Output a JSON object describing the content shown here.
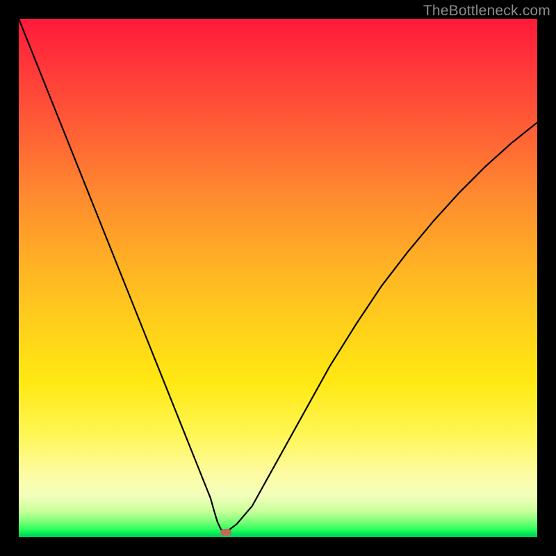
{
  "watermark": "TheBottleneck.com",
  "colors": {
    "frame": "#000000",
    "gradient_top": "#ff1a3a",
    "gradient_mid": "#ffd21a",
    "gradient_bottom": "#00cc5a",
    "curve": "#000000",
    "marker": "#c06a5a"
  },
  "chart_data": {
    "type": "line",
    "title": "",
    "xlabel": "",
    "ylabel": "",
    "xlim": [
      0,
      100
    ],
    "ylim": [
      0,
      100
    ],
    "minimum": {
      "x": 40,
      "y": 1
    },
    "series": [
      {
        "name": "bottleneck-curve",
        "x": [
          0,
          5,
          10,
          15,
          20,
          25,
          28,
          30,
          32,
          34,
          35,
          36,
          37,
          37.7,
          38.3,
          39,
          40,
          42,
          45,
          50,
          55,
          60,
          65,
          70,
          75,
          80,
          85,
          90,
          95,
          100
        ],
        "values": [
          100,
          87.5,
          75,
          62.5,
          50,
          37.5,
          30,
          25,
          20,
          15,
          12.5,
          10,
          7.5,
          5,
          3,
          1.5,
          1,
          2.5,
          6,
          15,
          24,
          33,
          41,
          48.5,
          55,
          61,
          66.5,
          71.5,
          76,
          80
        ]
      }
    ],
    "annotations": []
  }
}
